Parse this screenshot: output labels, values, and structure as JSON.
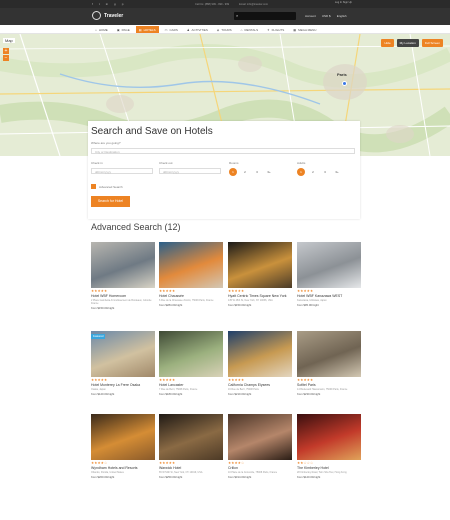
{
  "topbar": {
    "social": [
      "f",
      "t",
      "in",
      "g",
      "p"
    ],
    "phone": "Call Us: (888) 999 - 999 - 999",
    "email": "Email: info@traveler.com",
    "right": "Log In  Sign Up"
  },
  "header": {
    "logo": "Traveler",
    "search_placeholder": "Search",
    "user": [
      "Account",
      "USD $",
      "English"
    ]
  },
  "nav": {
    "items": [
      {
        "icon": "⌂",
        "label": "HOME"
      },
      {
        "icon": "▣",
        "label": "PAGE"
      },
      {
        "icon": "▤",
        "label": "HOTELS"
      },
      {
        "icon": "▭",
        "label": "CARS"
      },
      {
        "icon": "♟",
        "label": "ACTIVITIES"
      },
      {
        "icon": "◈",
        "label": "TOURS"
      },
      {
        "icon": "⌂",
        "label": "RENTALS"
      },
      {
        "icon": "✈",
        "label": "FLIGHTS"
      },
      {
        "icon": "▦",
        "label": "MEGA MENU"
      }
    ],
    "active": "HOTELS"
  },
  "map": {
    "tag": "Map",
    "zoom_in": "+",
    "zoom_out": "−",
    "buttons": [
      "Hide",
      "My Location",
      "Full Screen"
    ],
    "city": "Paris"
  },
  "panel": {
    "title": "Search and Save on Hotels",
    "where_label": "Where are you going?",
    "where_placeholder": "City or Destination",
    "checkin_label": "Check in",
    "checkin_placeholder": "dd/mm/yyyy",
    "checkout_label": "Check out",
    "checkout_placeholder": "dd/mm/yyyy",
    "rooms_label": "Rooms",
    "rooms": [
      "1",
      "2",
      "3",
      "3+"
    ],
    "adults_label": "Adults",
    "adults": [
      "1",
      "2",
      "3",
      "3+"
    ],
    "advanced": "Advanced Search",
    "button": "Search for Hotel"
  },
  "results": {
    "title": "Advanced Search (12)",
    "cards": [
      {
        "name": "Hotel WBF Homeroom",
        "addr": "2 Place Gambetta Arrondissement de Bordeaux, Gironde France",
        "price": "from $150.00/night",
        "stars": "★★★★★",
        "featured": "",
        "img": "street"
      },
      {
        "name": "Hotel Chaussée",
        "addr": "6 Rue de la Chaussée d'Antin, 75009 Paris, France",
        "price": "from $284.00/night",
        "stars": "★★★★★",
        "featured": "",
        "img": "lounge"
      },
      {
        "name": "Hyatt Centric Times Square New York",
        "addr": "135 W 45th St, New York, NY 10036, USA",
        "price": "from $150.00/night",
        "stars": "★★★★★",
        "featured": "",
        "img": "nightfront"
      },
      {
        "name": "Hotel WBF Kanazawa WEST",
        "addr": "Kanazawa, Ishikawa, Japan",
        "price": "from $95.00/night",
        "stars": "★★★★★",
        "featured": "",
        "img": "building"
      },
      {
        "name": "Hotel Monterey La Frere Osaka",
        "addr": "Osaka, Japan",
        "price": "from $120.00/night",
        "stars": "★★★★★",
        "featured": "Featured",
        "img": "classic"
      },
      {
        "name": "Hotel Lancaster",
        "addr": "7 Rue de Berri, 75008 Paris, France",
        "price": "from $180.00/night",
        "stars": "★★★★★",
        "featured": "",
        "img": "garden"
      },
      {
        "name": "California Champs Elysees",
        "addr": "16 Rue de Berri, 75008 Paris",
        "price": "from $210.00/night",
        "stars": "★★★★★",
        "featured": "",
        "img": "room"
      },
      {
        "name": "Sofitel Paris",
        "addr": "14 Boulevard Haussmann, 75009 Paris, France",
        "price": "from $230.00/night",
        "stars": "★★★★★",
        "featured": "",
        "img": "stone"
      },
      {
        "name": "Wyndham Hotels and Resorts",
        "addr": "Orlando, Florida, United States",
        "price": "from $200.00/night",
        "stars": "★★★★☆",
        "featured": "",
        "img": "resort"
      },
      {
        "name": "Warwick Hotel",
        "addr": "65 W 54th St, New York, NY 10019, USA",
        "price": "from $250.00/night",
        "stars": "★★★★★",
        "featured": "",
        "img": "darklobby"
      },
      {
        "name": "Crillon",
        "addr": "10 Place de la Concorde, 75008 Paris, France",
        "price": "from $314.00/night",
        "stars": "★★★★☆",
        "featured": "",
        "img": "hall"
      },
      {
        "name": "The Kimberley Hotel",
        "addr": "28 Kimberley Road, Tsim Sha Tsui, Hong Kong",
        "price": "from $120.00/night",
        "stars": "★★☆☆☆",
        "featured": "",
        "img": "redbar"
      }
    ]
  },
  "colors": {
    "accent": "#ed8323",
    "dark": "#333333",
    "featured": "#3aa6dd"
  }
}
